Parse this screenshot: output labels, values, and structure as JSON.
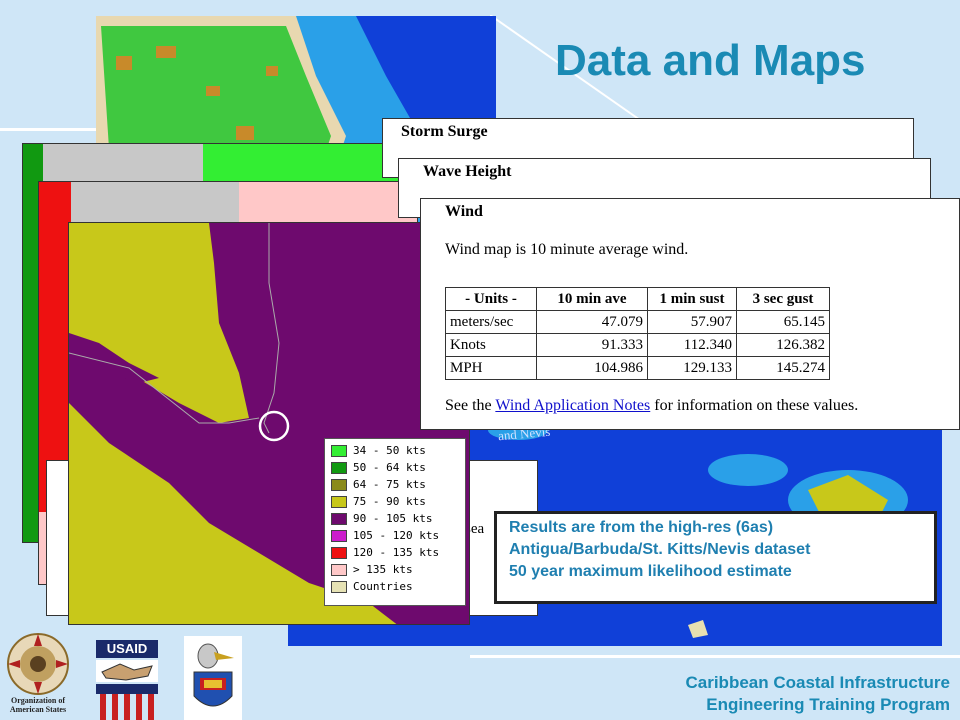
{
  "slide": {
    "title": "Data and Maps"
  },
  "storm_surge_panel": {
    "title": "Storm Surge"
  },
  "wave_height_panel": {
    "title": "Wave Height"
  },
  "wind_panel": {
    "title": "Wind",
    "description": "Wind map is 10 minute average wind.",
    "table": {
      "headers": [
        "- Units -",
        "10 min ave",
        "1 min sust",
        "3 sec gust"
      ],
      "rows": [
        [
          "meters/sec",
          "47.079",
          "57.907",
          "65.145"
        ],
        [
          "Knots",
          "91.333",
          "112.340",
          "126.382"
        ],
        [
          "MPH",
          "104.986",
          "129.133",
          "145.274"
        ]
      ]
    },
    "note_prefix": "See the ",
    "note_link": "Wind Application Notes",
    "note_suffix": " for information on these values."
  },
  "legend": {
    "items": [
      {
        "label": "34 - 50 kts",
        "color": "#33ee33"
      },
      {
        "label": "50 - 64 kts",
        "color": "#119911"
      },
      {
        "label": "64 - 75 kts",
        "color": "#8a8a1a"
      },
      {
        "label": "75 - 90 kts",
        "color": "#c8c81a"
      },
      {
        "label": "90 - 105 kts",
        "color": "#6e0a6e"
      },
      {
        "label": "105 - 120 kts",
        "color": "#cc1ccc"
      },
      {
        "label": "120 - 135 kts",
        "color": "#ee1111"
      },
      {
        "label": "> 135 kts",
        "color": "#ffc8c8"
      },
      {
        "label": "Countries",
        "color": "#e6e2b4"
      }
    ]
  },
  "results_box": {
    "line1": "Results are from the high-res (6as)",
    "line2": "Antigua/Barbuda/St. Kitts/Nevis dataset",
    "line3": "50 year maximum likelihood estimate"
  },
  "partial_text": {
    "sea": "sea",
    "nevis": "and Nevis"
  },
  "footer": {
    "line1": "Caribbean Coastal Infrastructure",
    "line2": "Engineering Training Program"
  },
  "logos": {
    "oas": "Organization of American States",
    "usaid": "USAID"
  },
  "colors": {
    "title": "#1a8ab4",
    "ocean": "#1040d8",
    "land_green": "#40c840",
    "wind_yellow": "#c8c81a",
    "wind_purple": "#6e0a6e",
    "link": "#1010cc"
  }
}
